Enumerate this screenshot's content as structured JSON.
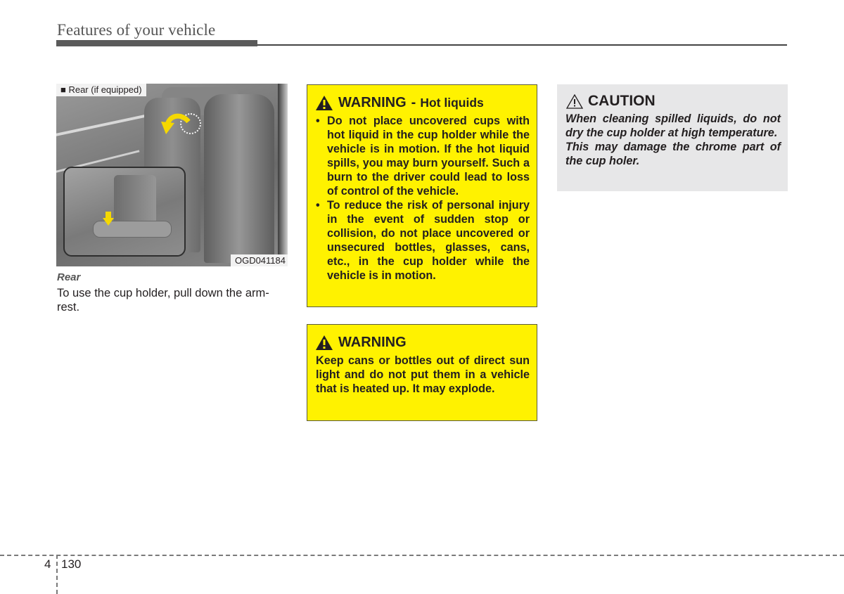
{
  "header": {
    "section_title": "Features of your vehicle"
  },
  "figure": {
    "caption": "■ Rear (if equipped)",
    "code": "OGD041184",
    "icons": [
      "curved-arrow-icon",
      "down-arrow-icon"
    ],
    "accent_color": "#f5d800"
  },
  "left_column": {
    "heading": "Rear",
    "body": "To use the cup holder, pull down the arm-rest."
  },
  "warning_hot_liquids": {
    "icon": "warning-triangle-icon",
    "title": "WARNING",
    "separator": "-",
    "subtitle": "Hot liquids",
    "bullets": [
      "Do not place uncovered cups with hot liquid in the cup holder while the vehicle is in motion. If the hot liquid spills, you may burn yourself. Such a burn to the driver could lead to loss of control of the vehicle.",
      "To reduce the risk of personal injury in the event of sudden stop or collision, do not place uncovered or unsecured bottles, glasses, cans, etc., in the cup holder while the vehicle is in motion."
    ],
    "background_color": "#fff200"
  },
  "warning_explode": {
    "icon": "warning-triangle-icon",
    "title": "WARNING",
    "text": "Keep cans or bottles out of direct sun light and do not put them in a vehicle that is heated up. It may explode.",
    "background_color": "#fff200"
  },
  "caution": {
    "icon": "caution-triangle-icon",
    "title": "CAUTION",
    "paragraphs": [
      "When cleaning spilled liquids, do not dry the cup holder at high temperature.",
      "This may damage the chrome part of the cup holer."
    ],
    "background_color": "#e7e7e8"
  },
  "footer": {
    "chapter": "4",
    "page": "130"
  }
}
